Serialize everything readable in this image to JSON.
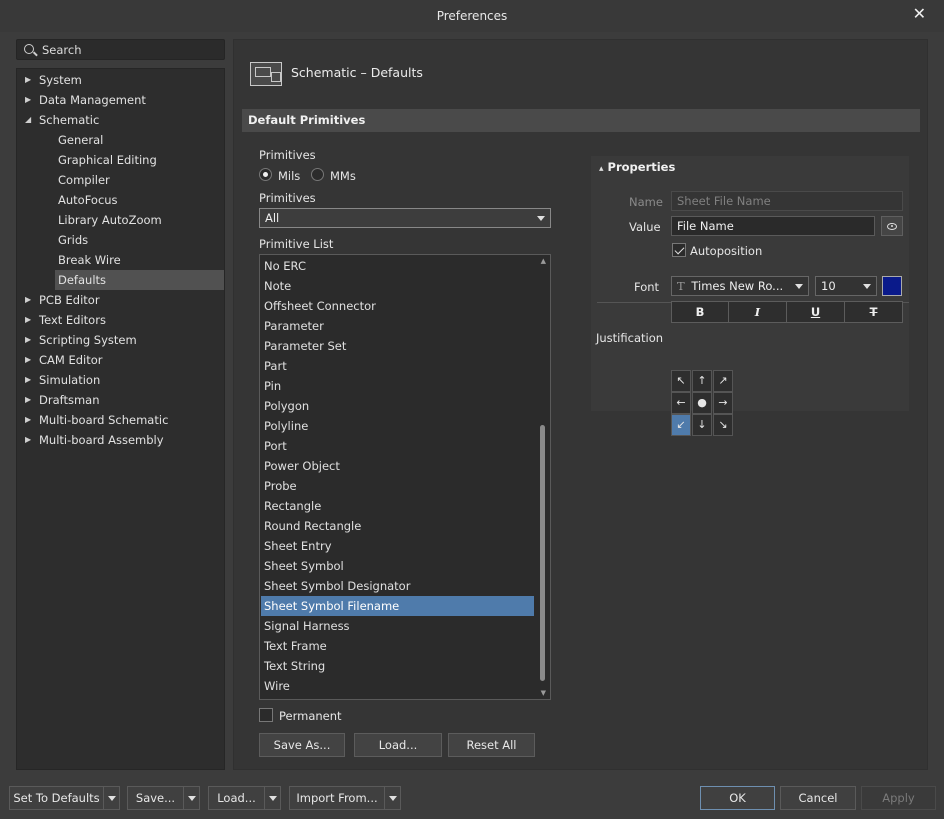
{
  "window": {
    "title": "Preferences",
    "close_icon": "close-icon"
  },
  "search": {
    "placeholder": "Search"
  },
  "tree": {
    "items": [
      {
        "label": "System",
        "expanded": false
      },
      {
        "label": "Data Management",
        "expanded": false
      },
      {
        "label": "Schematic",
        "expanded": true
      },
      {
        "label": "General"
      },
      {
        "label": "Graphical Editing"
      },
      {
        "label": "Compiler"
      },
      {
        "label": "AutoFocus"
      },
      {
        "label": "Library AutoZoom"
      },
      {
        "label": "Grids"
      },
      {
        "label": "Break Wire"
      },
      {
        "label": "Defaults",
        "selected": true
      },
      {
        "label": "PCB Editor",
        "expanded": false
      },
      {
        "label": "Text Editors",
        "expanded": false
      },
      {
        "label": "Scripting System",
        "expanded": false
      },
      {
        "label": "CAM Editor",
        "expanded": false
      },
      {
        "label": "Simulation",
        "expanded": false
      },
      {
        "label": "Draftsman",
        "expanded": false
      },
      {
        "label": "Multi-board Schematic",
        "expanded": false
      },
      {
        "label": "Multi-board Assembly",
        "expanded": false
      }
    ]
  },
  "page": {
    "title": "Schematic – Defaults",
    "section": "Default Primitives"
  },
  "primitives": {
    "units_label": "Primitives",
    "unit_mils": "Mils",
    "unit_mms": "MMs",
    "selected_unit": "Mils",
    "filter_label": "Primitives",
    "filter_value": "All",
    "list_label": "Primitive List",
    "list": [
      "No ERC",
      "Note",
      "Offsheet Connector",
      "Parameter",
      "Parameter Set",
      "Part",
      "Pin",
      "Polygon",
      "Polyline",
      "Port",
      "Power Object",
      "Probe",
      "Rectangle",
      "Round Rectangle",
      "Sheet Entry",
      "Sheet Symbol",
      "Sheet Symbol Designator",
      "Sheet Symbol Filename",
      "Signal Harness",
      "Text Frame",
      "Text String",
      "Wire"
    ],
    "selected": "Sheet Symbol Filename",
    "permanent_label": "Permanent",
    "permanent_checked": false,
    "save_as": "Save As...",
    "load": "Load...",
    "reset_all": "Reset All"
  },
  "properties": {
    "title": "Properties",
    "name_label": "Name",
    "name_value": "Sheet File Name",
    "value_label": "Value",
    "value_value": "File Name",
    "autoposition_label": "Autoposition",
    "autoposition_checked": true,
    "font_label": "Font",
    "font_value": "Times New Ro...",
    "font_size": "10",
    "font_color": "#0a1a8a",
    "format_buttons": [
      "B",
      "I",
      "U",
      "T"
    ],
    "justification_label": "Justification",
    "justification_arrows": [
      "↖",
      "↑",
      "↗",
      "←",
      "●",
      "→",
      "↙",
      "↓",
      "↘"
    ],
    "justification_selected": 6
  },
  "footer": {
    "set_to_defaults": "Set To Defaults",
    "save": "Save...",
    "load": "Load...",
    "import_from": "Import From...",
    "ok": "OK",
    "cancel": "Cancel",
    "apply": "Apply"
  }
}
